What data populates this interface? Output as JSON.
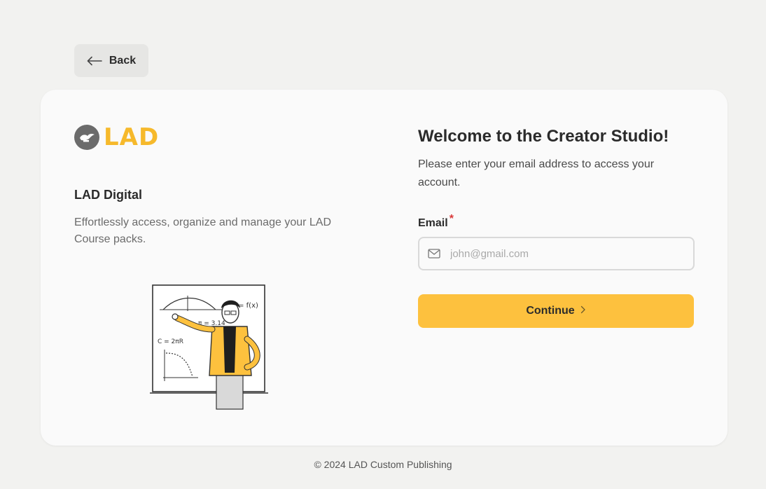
{
  "nav": {
    "back_label": "Back"
  },
  "brand": {
    "logo_text": "LAD",
    "title": "LAD Digital",
    "description": "Effortlessly access, organize and manage your LAD Course packs."
  },
  "login": {
    "welcome": "Welcome to the Creator Studio!",
    "subtitle": "Please enter your email address to access your account.",
    "email_label": "Email",
    "required_mark": "*",
    "email_placeholder": "john@gmail.com",
    "email_value": "",
    "continue_label": "Continue"
  },
  "footer": {
    "copyright": "© 2024 LAD Custom Publishing"
  },
  "illustration": {
    "board_text": [
      "y = f(x)",
      "π = 3.14",
      "C = 2πR"
    ]
  },
  "colors": {
    "accent": "#fdc13e",
    "logo_gray": "#6b6b6b",
    "required": "#d93a3a",
    "background": "#f2f2f0",
    "card": "#fafafa"
  },
  "icons": [
    "arrow-left-icon",
    "lamp-icon",
    "mail-icon",
    "chevron-right-icon"
  ]
}
